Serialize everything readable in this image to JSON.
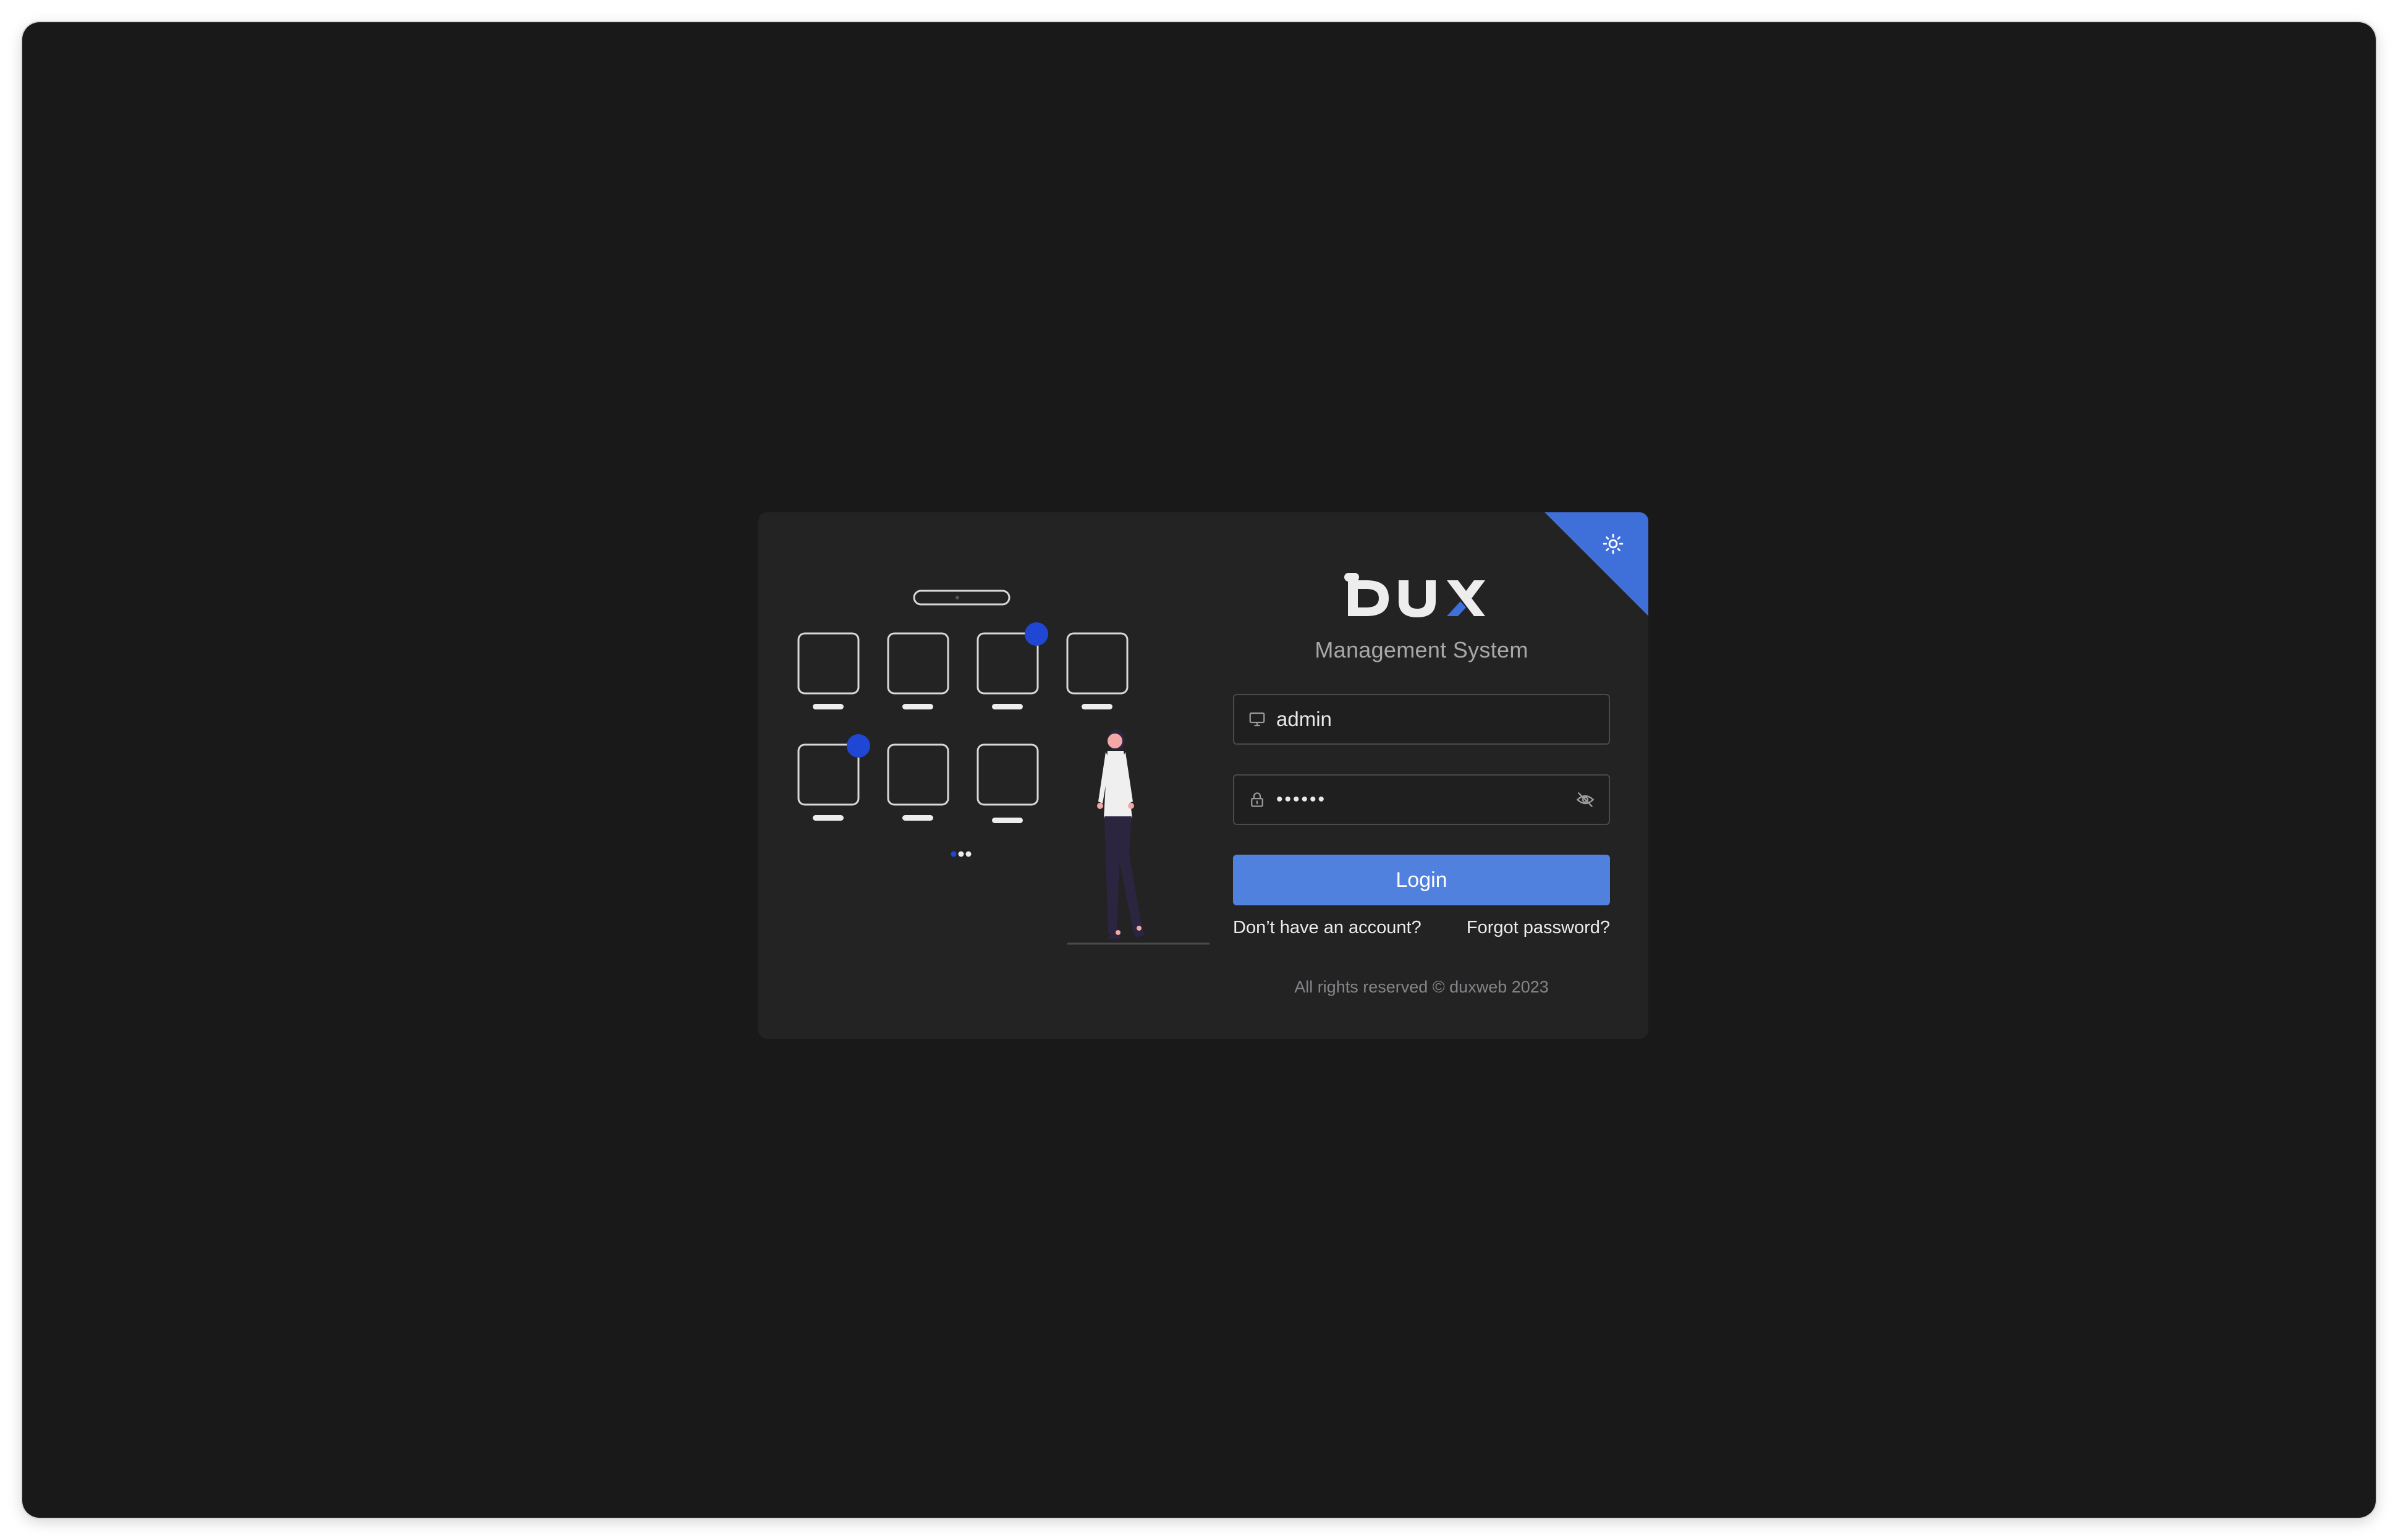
{
  "app": {
    "logo_text": "DUX",
    "subtitle": "Management System"
  },
  "theme_toggle": {
    "icon": "sun-icon",
    "accent_color": "#3f6fd8"
  },
  "login_form": {
    "username": {
      "icon": "monitor-icon",
      "value": "admin"
    },
    "password": {
      "icon": "lock-icon",
      "value": "••••••",
      "toggle_icon": "eye-off-icon"
    },
    "login_button_label": "Login",
    "register_link": "Don’t have an account?",
    "forgot_link": "Forgot password?"
  },
  "footer": {
    "copyright": "All rights reserved © duxweb 2023"
  },
  "colors": {
    "background": "#191919",
    "card": "#232324",
    "primary": "#5181df",
    "illustration_accent": "#1f47d4"
  }
}
